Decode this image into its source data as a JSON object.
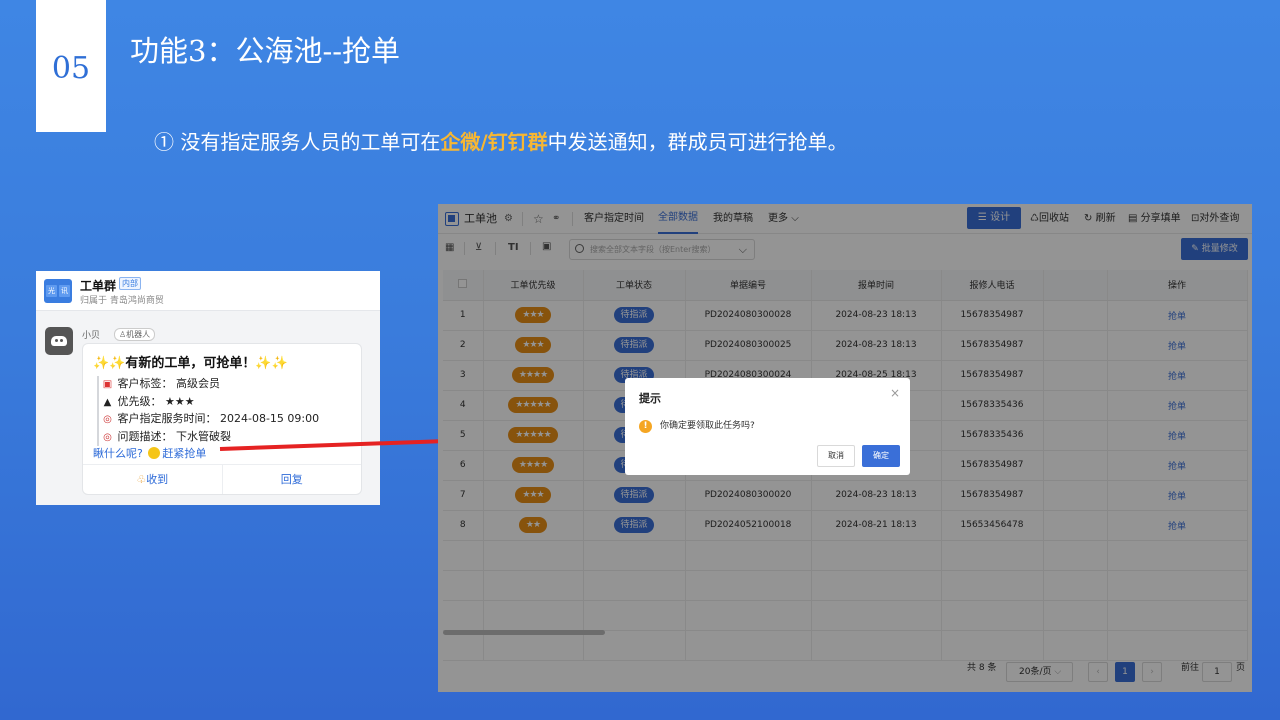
{
  "slide": {
    "number": "05",
    "title": "功能3：公海池--抢单",
    "subtitle_pre": "① 没有指定服务人员的工单可在",
    "subtitle_hl": "企微/钉钉群",
    "subtitle_post": "中发送通知，群成员可进行抢单。"
  },
  "chat": {
    "group_avatar": [
      "光",
      "讯"
    ],
    "group_name": "工单群",
    "group_tag": "内部",
    "group_belong": "归属于 青岛鸿尚商贸",
    "sender": "小贝",
    "robot_tag": "机器人",
    "msg_spark": "✨✨",
    "msg_title": "有新的工单，可抢单！",
    "msg_spark_end": "✨✨",
    "rows": [
      {
        "icon": "▣",
        "label": "客户标签：",
        "value": "高级会员"
      },
      {
        "icon": "▲",
        "label": "优先级：",
        "value": "★★★"
      },
      {
        "icon": "◎",
        "label": "客户指定服务时间：",
        "value": "2024-08-15 09:00"
      },
      {
        "icon": "◎",
        "label": "问题描述：",
        "value": "下水管破裂"
      }
    ],
    "link_prefix": "瞅什么呢?",
    "link_action": "赶紧抢单",
    "footer_receive": "收到",
    "footer_reply": "回复",
    "arrow_color": "#e52222"
  },
  "app": {
    "accent": "#3a6fd8",
    "title": "工单池",
    "tabs": [
      "客户指定时间",
      "全部数据",
      "我的草稿",
      "更多"
    ],
    "active_tab": "全部数据",
    "design_btn": "设计",
    "recycle": "回收站",
    "refresh": "刷新",
    "share": "分享填单",
    "external": "对外查询",
    "search_placeholder": "搜索全部文本字段（按Enter搜索）",
    "batch_btn": "批量修改",
    "columns": [
      "工单优先级",
      "工单状态",
      "单据编号",
      "报单时间",
      "报修人电话",
      "操作"
    ],
    "rows": [
      {
        "idx": "1",
        "priority": "★★★",
        "status": "待指派",
        "code": "PD2024080300028",
        "time": "2024-08-23 18:13",
        "phone": "15678354987",
        "action": "抢单"
      },
      {
        "idx": "2",
        "priority": "★★★",
        "status": "待指派",
        "code": "PD2024080300025",
        "time": "2024-08-23 18:13",
        "phone": "15678354987",
        "action": "抢单"
      },
      {
        "idx": "3",
        "priority": "★★★★",
        "status": "待指派",
        "code": "PD2024080300024",
        "time": "2024-08-25 18:13",
        "phone": "15678354987",
        "action": "抢单"
      },
      {
        "idx": "4",
        "priority": "★★★★★",
        "status": "待指派",
        "code": "",
        "time": "13",
        "phone": "15678335436",
        "action": "抢单"
      },
      {
        "idx": "5",
        "priority": "★★★★★",
        "status": "待指派",
        "code": "",
        "time": "13",
        "phone": "15678335436",
        "action": "抢单"
      },
      {
        "idx": "6",
        "priority": "★★★★",
        "status": "待指派",
        "code": "",
        "time": "13",
        "phone": "15678354987",
        "action": "抢单"
      },
      {
        "idx": "7",
        "priority": "★★★",
        "status": "待指派",
        "code": "PD2024080300020",
        "time": "2024-08-23 18:13",
        "phone": "15678354987",
        "action": "抢单"
      },
      {
        "idx": "8",
        "priority": "★★",
        "status": "待指派",
        "code": "PD2024052100018",
        "time": "2024-08-21 18:13",
        "phone": "15653456478",
        "action": "抢单"
      }
    ],
    "total": "共 8 条",
    "page_size": "20条/页",
    "page_current": "1",
    "goto_label": "前往",
    "goto_value": "1",
    "page_unit": "页"
  },
  "dialog": {
    "title": "提示",
    "message": "你确定要领取此任务吗?",
    "cancel": "取消",
    "confirm": "确定"
  }
}
